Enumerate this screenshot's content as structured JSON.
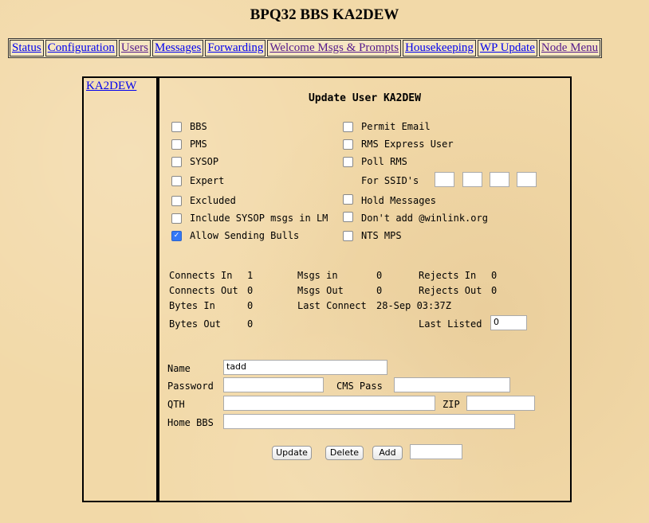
{
  "page": {
    "title": "BPQ32 BBS KA2DEW"
  },
  "nav": {
    "items": [
      {
        "label": "Status"
      },
      {
        "label": "Configuration"
      },
      {
        "label": "Users"
      },
      {
        "label": "Messages"
      },
      {
        "label": "Forwarding"
      },
      {
        "label": "Welcome Msgs & Prompts"
      },
      {
        "label": "Housekeeping"
      },
      {
        "label": "WP Update"
      },
      {
        "label": "Node Menu"
      }
    ]
  },
  "user_list": {
    "items": [
      {
        "label": "KA2DEW"
      }
    ]
  },
  "form": {
    "title": "Update User KA2DEW",
    "flags_left": [
      {
        "label": "BBS",
        "checked": false
      },
      {
        "label": "PMS",
        "checked": false
      },
      {
        "label": "SYSOP",
        "checked": false
      },
      {
        "label": "Expert",
        "checked": false
      },
      {
        "label": "Excluded",
        "checked": false
      },
      {
        "label": "Include SYSOP msgs in LM",
        "checked": false
      },
      {
        "label": "Allow Sending Bulls",
        "checked": true
      }
    ],
    "flags_right": [
      {
        "label": "Permit Email",
        "checked": false
      },
      {
        "label": "RMS Express User",
        "checked": false
      },
      {
        "label": "Poll RMS",
        "checked": false
      },
      {
        "label": "Hold Messages",
        "checked": false
      },
      {
        "label": "Don't add @winlink.org",
        "checked": false
      },
      {
        "label": "NTS MPS",
        "checked": false
      }
    ],
    "ssid_label": "For SSID's",
    "ssid_values": [
      "",
      "",
      "",
      ""
    ],
    "stats": {
      "connects_in_label": "Connects In",
      "connects_in": "1",
      "connects_out_label": "Connects Out",
      "connects_out": "0",
      "bytes_in_label": "Bytes In",
      "bytes_in": "0",
      "bytes_out_label": "Bytes Out",
      "bytes_out": "0",
      "msgs_in_label": "Msgs in",
      "msgs_in": "0",
      "msgs_out_label": "Msgs Out",
      "msgs_out": "0",
      "last_connect_label": "Last Connect",
      "last_connect": "28-Sep 03:37Z",
      "rejects_in_label": "Rejects In",
      "rejects_in": "0",
      "rejects_out_label": "Rejects Out",
      "rejects_out": "0",
      "last_listed_label": "Last Listed",
      "last_listed": "0"
    },
    "fields": {
      "name_label": "Name",
      "name_value": "tadd",
      "password_label": "Password",
      "password_value": "",
      "cms_pass_label": "CMS Pass",
      "cms_pass_value": "",
      "qth_label": "QTH",
      "qth_value": "",
      "zip_label": "ZIP",
      "zip_value": "",
      "home_bbs_label": "Home BBS",
      "home_bbs_value": ""
    },
    "buttons": {
      "update": "Update",
      "delete": "Delete",
      "add": "Add",
      "add_value": ""
    }
  }
}
